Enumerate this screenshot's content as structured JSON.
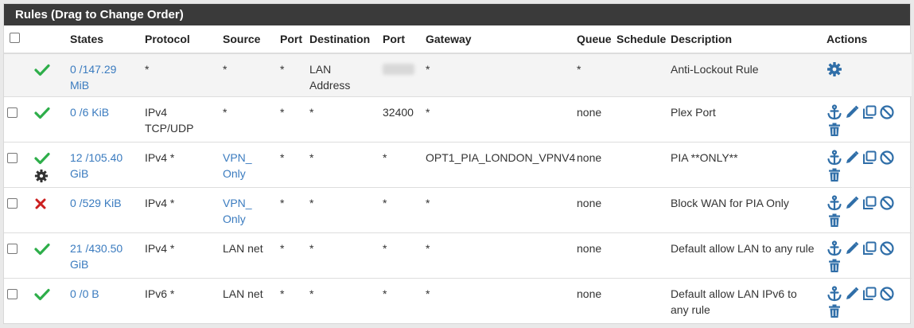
{
  "panel": {
    "title": "Rules (Drag to Change Order)"
  },
  "columns": {
    "states": "States",
    "protocol": "Protocol",
    "source": "Source",
    "port": "Port",
    "destination": "Destination",
    "dport": "Port",
    "gateway": "Gateway",
    "queue": "Queue",
    "schedule": "Schedule",
    "description": "Description",
    "actions": "Actions"
  },
  "rules": [
    {
      "status": "pass",
      "states1": "0 /147.29",
      "states2": "MiB",
      "protocol1": "*",
      "protocol2": "",
      "source1": "*",
      "source2": "",
      "sport": "*",
      "dest1": "LAN",
      "dest2": "Address",
      "dport": "",
      "gateway": "*",
      "queue": "*",
      "schedule": "",
      "desc1": "Anti-Lockout Rule",
      "desc2": ""
    },
    {
      "status": "pass",
      "states1": "0 /6 KiB",
      "states2": "",
      "protocol1": "IPv4",
      "protocol2": "TCP/UDP",
      "source1": "*",
      "source2": "",
      "sport": "*",
      "dest1": "*",
      "dest2": "",
      "dport": "32400",
      "gateway": "*",
      "queue": "none",
      "schedule": "",
      "desc1": "Plex Port",
      "desc2": ""
    },
    {
      "status": "pass",
      "states1": "12 /105.40",
      "states2": "GiB",
      "protocol1": "IPv4 *",
      "protocol2": "",
      "source1": "VPN_",
      "source2": "Only",
      "sport": "*",
      "dest1": "*",
      "dest2": "",
      "dport": "*",
      "gateway": "OPT1_PIA_LONDON_VPNV4",
      "queue": "none",
      "schedule": "",
      "desc1": "PIA **ONLY**",
      "desc2": ""
    },
    {
      "status": "block",
      "states1": "0 /529 KiB",
      "states2": "",
      "protocol1": "IPv4 *",
      "protocol2": "",
      "source1": "VPN_",
      "source2": "Only",
      "sport": "*",
      "dest1": "*",
      "dest2": "",
      "dport": "*",
      "gateway": "*",
      "queue": "none",
      "schedule": "",
      "desc1": "Block WAN for PIA Only",
      "desc2": ""
    },
    {
      "status": "pass",
      "states1": "21 /430.50",
      "states2": "GiB",
      "protocol1": "IPv4 *",
      "protocol2": "",
      "source1": "LAN net",
      "source2": "",
      "sport": "*",
      "dest1": "*",
      "dest2": "",
      "dport": "*",
      "gateway": "*",
      "queue": "none",
      "schedule": "",
      "desc1": "Default allow LAN to any rule",
      "desc2": ""
    },
    {
      "status": "pass",
      "states1": "0 /0 B",
      "states2": "",
      "protocol1": "IPv6 *",
      "protocol2": "",
      "source1": "LAN net",
      "source2": "",
      "sport": "*",
      "dest1": "*",
      "dest2": "",
      "dport": "*",
      "gateway": "*",
      "queue": "none",
      "schedule": "",
      "desc1": "Default allow LAN IPv6 to",
      "desc2": "any rule"
    }
  ],
  "icons": {
    "pass": "check-icon",
    "block": "x-icon",
    "advanced": "gear-icon",
    "actions": [
      "anchor-icon",
      "pencil-icon",
      "copy-icon",
      "disable-icon",
      "trash-icon"
    ]
  },
  "colors": {
    "header_bg": "#3a3a3a",
    "link_blue": "#3a7bbf",
    "pass_green": "#2eae4a",
    "block_red": "#cc1f1f",
    "action_blue": "#2f6ea8"
  }
}
